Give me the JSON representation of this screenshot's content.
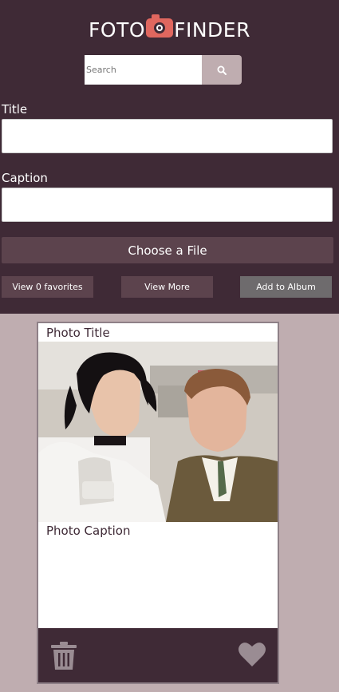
{
  "logo": {
    "left": "FOTO",
    "right": "FINDER",
    "icon": "camera-icon"
  },
  "search": {
    "placeholder": "Search",
    "value": "",
    "icon": "search-icon"
  },
  "form": {
    "title_label": "Title",
    "title_value": "",
    "caption_label": "Caption",
    "caption_value": "",
    "choose_file_label": "Choose a File"
  },
  "actions": {
    "view_favorites": "View 0 favorites",
    "view_more": "View More",
    "add_to_album": "Add to Album"
  },
  "card": {
    "title": "Photo Title",
    "caption": "Photo Caption",
    "delete_icon": "trash-icon",
    "favorite_icon": "heart-icon"
  },
  "colors": {
    "header_bg": "#3f2a36",
    "page_bg": "#bfadb0",
    "accent": "#e0675f",
    "button_bg": "#5c434d",
    "album_button_bg": "#6e6b6d"
  }
}
